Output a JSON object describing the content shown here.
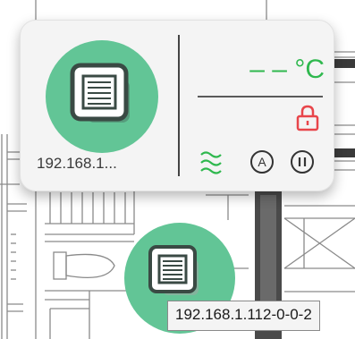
{
  "device_card": {
    "device_icon": "ceiling-cassette-ac-icon",
    "ip_truncated": "192.168.1...",
    "temperature_value": "– –",
    "temperature_unit": "°C",
    "lock_icon": "lock-icon",
    "fan_speed_icon": "fan-speed-waves-icon",
    "auto_mode_icon": "auto-mode-icon",
    "auto_mode_label": "A",
    "pause_icon": "pause-icon"
  },
  "map_device": {
    "device_icon": "ceiling-cassette-ac-icon",
    "tooltip": "192.168.1.112-0-0-2"
  },
  "colors": {
    "device_green": "#62c596",
    "temperature_green": "#2fb84e",
    "lock_red": "#e8454a"
  }
}
